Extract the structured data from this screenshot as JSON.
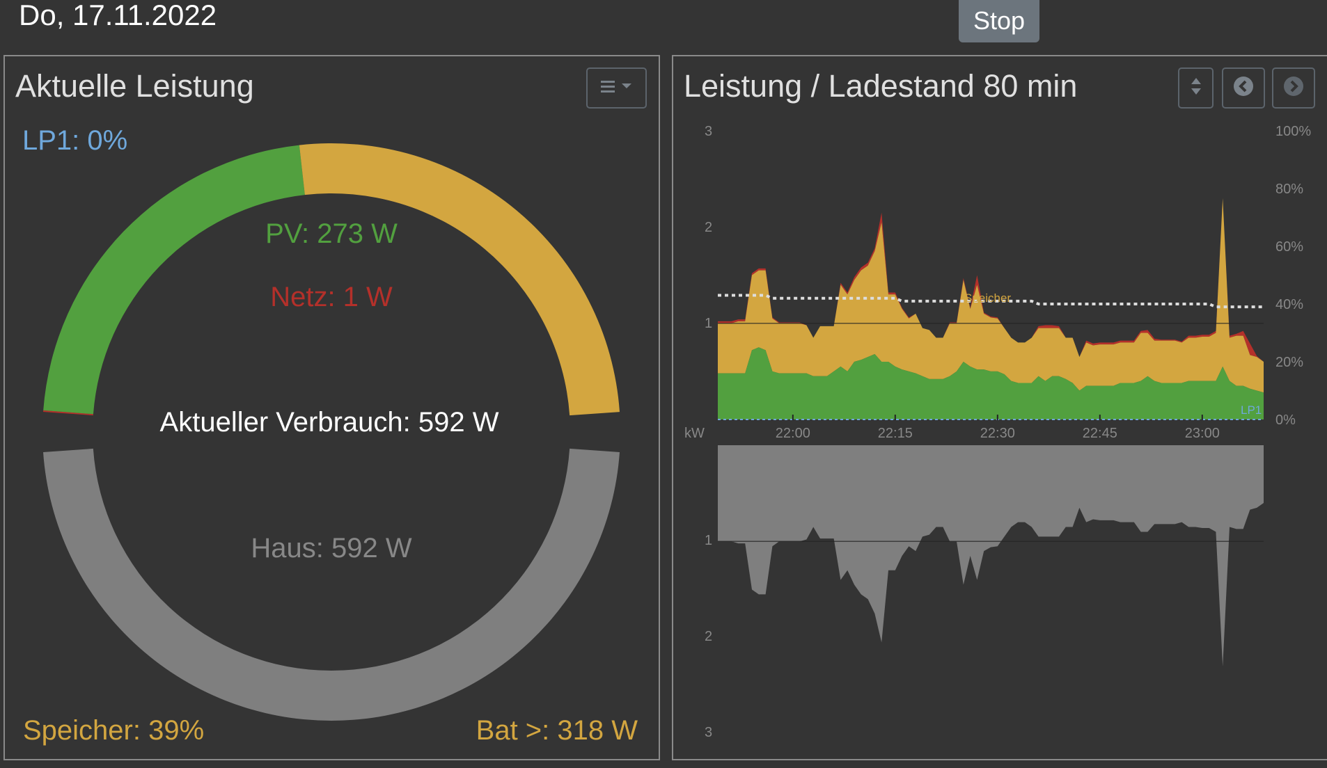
{
  "header": {
    "date": "Do, 17.11.2022",
    "stop_label": "Stop"
  },
  "colors": {
    "pv": "#52a03f",
    "battery": "#d3a640",
    "grid": "#b4302a",
    "house": "#7f7f7f",
    "lp": "#6fa8dc",
    "background": "#343434"
  },
  "left_panel": {
    "title": "Aktuelle Leistung",
    "menu_icon": "list-icon",
    "lp1_label": "LP1: 0%",
    "pv_label": "PV: 273 W",
    "grid_label": "Netz: 1 W",
    "consumption_label": "Aktueller Verbrauch: 592 W",
    "house_label": "Haus: 592 W",
    "storage_label": "Speicher: 39%",
    "battery_label": "Bat >: 318 W",
    "gauge": {
      "source_w": {
        "grid": 1,
        "pv": 273,
        "battery": 318
      },
      "consumer_w": {
        "house": 592
      }
    }
  },
  "right_panel": {
    "title": "Leistung / Ladestand 80 min",
    "buttons": [
      "sort-icon",
      "chevron-left-icon",
      "chevron-right-icon"
    ]
  },
  "chart_data": {
    "type": "area",
    "title": "Leistung / Ladestand 80 min",
    "ylabel": "kW",
    "ylim": [
      0,
      3
    ],
    "y2lim": [
      0,
      100
    ],
    "yticks": [
      "1",
      "2",
      "3"
    ],
    "y2ticks": [
      "0%",
      "20%",
      "40%",
      "60%",
      "80%",
      "100%"
    ],
    "lower_yticks": [
      "1",
      "2",
      "3"
    ],
    "xticks": [
      {
        "minute": 11,
        "label": "22:00"
      },
      {
        "minute": 26,
        "label": "22:15"
      },
      {
        "minute": 41,
        "label": "22:30"
      },
      {
        "minute": 56,
        "label": "22:45"
      },
      {
        "minute": 71,
        "label": "23:00"
      }
    ],
    "start_time": "21:49",
    "annotations": {
      "soc_label": "Speicher",
      "lp_label": "LP1"
    },
    "series": [
      {
        "name": "PV",
        "unit": "kW",
        "values": [
          0.48,
          0.48,
          0.48,
          0.48,
          0.48,
          0.72,
          0.75,
          0.72,
          0.5,
          0.48,
          0.48,
          0.48,
          0.48,
          0.48,
          0.45,
          0.45,
          0.45,
          0.5,
          0.55,
          0.5,
          0.6,
          0.62,
          0.65,
          0.68,
          0.6,
          0.6,
          0.55,
          0.52,
          0.5,
          0.48,
          0.45,
          0.42,
          0.42,
          0.42,
          0.45,
          0.5,
          0.6,
          0.55,
          0.52,
          0.52,
          0.5,
          0.5,
          0.47,
          0.4,
          0.38,
          0.38,
          0.38,
          0.45,
          0.4,
          0.45,
          0.45,
          0.42,
          0.38,
          0.3,
          0.35,
          0.35,
          0.35,
          0.35,
          0.35,
          0.38,
          0.38,
          0.38,
          0.4,
          0.45,
          0.4,
          0.38,
          0.38,
          0.38,
          0.38,
          0.4,
          0.4,
          0.4,
          0.4,
          0.4,
          0.55,
          0.4,
          0.35,
          0.35,
          0.32,
          0.3,
          0.28
        ]
      },
      {
        "name": "Netz",
        "unit": "kW",
        "values": [
          0.02,
          0.02,
          0.02,
          0.02,
          0.02,
          0.02,
          0.02,
          0.02,
          0.01,
          0.01,
          0.01,
          0.01,
          0.01,
          0.0,
          0.0,
          0.0,
          0.0,
          0.0,
          0.02,
          0.02,
          0.03,
          0.03,
          0.03,
          0.03,
          0.1,
          0.02,
          0.02,
          0.01,
          0.01,
          0.0,
          0.0,
          0.0,
          0.0,
          0.0,
          0.01,
          0.01,
          0.02,
          0.01,
          0.1,
          0.01,
          0.01,
          0.01,
          0.0,
          0.0,
          0.0,
          0.0,
          0.0,
          0.02,
          0.03,
          0.03,
          0.02,
          0.0,
          0.0,
          0.0,
          0.02,
          0.02,
          0.02,
          0.02,
          0.02,
          0.02,
          0.02,
          0.02,
          0.02,
          0.03,
          0.02,
          0.01,
          0.01,
          0.01,
          0.01,
          0.02,
          0.02,
          0.02,
          0.02,
          0.02,
          0.0,
          0.02,
          0.02,
          0.05,
          0.12,
          0.01,
          0.0
        ]
      },
      {
        "name": "Haus",
        "unit": "kW",
        "values": [
          1.0,
          1.0,
          1.0,
          1.02,
          1.02,
          1.5,
          1.55,
          1.55,
          1.05,
          1.0,
          1.0,
          1.0,
          1.0,
          0.98,
          0.85,
          0.97,
          0.97,
          0.97,
          1.4,
          1.3,
          1.45,
          1.55,
          1.6,
          1.75,
          2.05,
          1.3,
          1.3,
          1.15,
          1.05,
          1.1,
          0.95,
          0.93,
          0.85,
          0.85,
          1.0,
          1.0,
          1.45,
          1.15,
          1.4,
          1.1,
          1.06,
          1.05,
          0.95,
          0.85,
          0.8,
          0.8,
          0.85,
          0.95,
          0.95,
          0.95,
          0.95,
          0.85,
          0.85,
          0.65,
          0.8,
          0.77,
          0.78,
          0.78,
          0.78,
          0.8,
          0.8,
          0.8,
          0.9,
          0.9,
          0.82,
          0.82,
          0.82,
          0.82,
          0.8,
          0.85,
          0.85,
          0.86,
          0.86,
          0.9,
          2.3,
          0.85,
          0.87,
          0.87,
          0.67,
          0.65,
          0.6
        ]
      },
      {
        "name": "Speicher",
        "unit": "%",
        "values": [
          43,
          43,
          43,
          43,
          43,
          43,
          43,
          43,
          42,
          42,
          42,
          42,
          42,
          42,
          42,
          42,
          42,
          42,
          42,
          42,
          42,
          42,
          42,
          42,
          42,
          42,
          42,
          41,
          41,
          41,
          41,
          41,
          41,
          41,
          41,
          41,
          41,
          41,
          41,
          41,
          41,
          41,
          41,
          41,
          41,
          41,
          41,
          40,
          40,
          40,
          40,
          40,
          40,
          40,
          40,
          40,
          40,
          40,
          40,
          40,
          40,
          40,
          40,
          40,
          40,
          40,
          40,
          40,
          40,
          40,
          40,
          40,
          40,
          39,
          39,
          39,
          39,
          39,
          39,
          39,
          39
        ]
      },
      {
        "name": "LP1",
        "unit": "%",
        "values": [
          0,
          0
        ]
      }
    ]
  }
}
